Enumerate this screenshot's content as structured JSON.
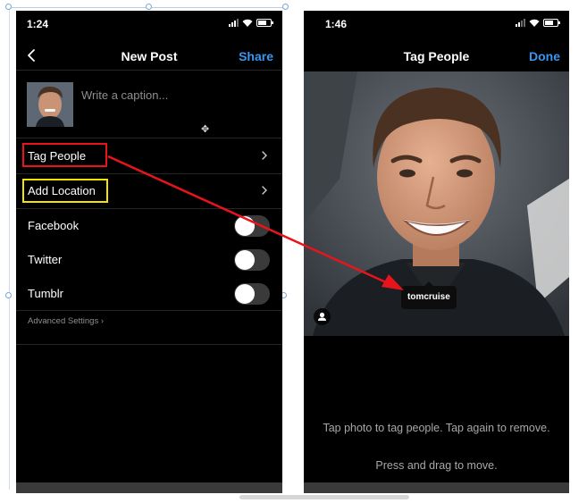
{
  "left_screen": {
    "status": {
      "time": "1:24"
    },
    "nav": {
      "title": "New Post",
      "action": "Share"
    },
    "caption_placeholder": "Write a caption...",
    "rows": {
      "tag_people": "Tag People",
      "add_location": "Add Location"
    },
    "shares": {
      "facebook": "Facebook",
      "twitter": "Twitter",
      "tumblr": "Tumblr"
    },
    "advanced_settings": "Advanced Settings"
  },
  "right_screen": {
    "status": {
      "time": "1:46"
    },
    "nav": {
      "title": "Tag People",
      "action": "Done"
    },
    "tag_label": "tomcruise",
    "hint_primary": "Tap photo to tag people. Tap again to remove.",
    "hint_secondary": "Press and drag to move."
  },
  "annotations": {
    "tag_people_highlight_color": "#e8141b",
    "add_location_highlight_color": "#f5e400",
    "arrow_color": "#e8141b"
  },
  "colors": {
    "accent": "#3897f0",
    "background": "#000000",
    "toggle_track": "#3a3a3a",
    "secondary_text": "#8e8e8e"
  },
  "icons": [
    "back-chevron-icon",
    "move-cursor-icon",
    "chevron-right-icon",
    "person-icon",
    "wifi-icon",
    "battery-icon",
    "signal-icon"
  ]
}
